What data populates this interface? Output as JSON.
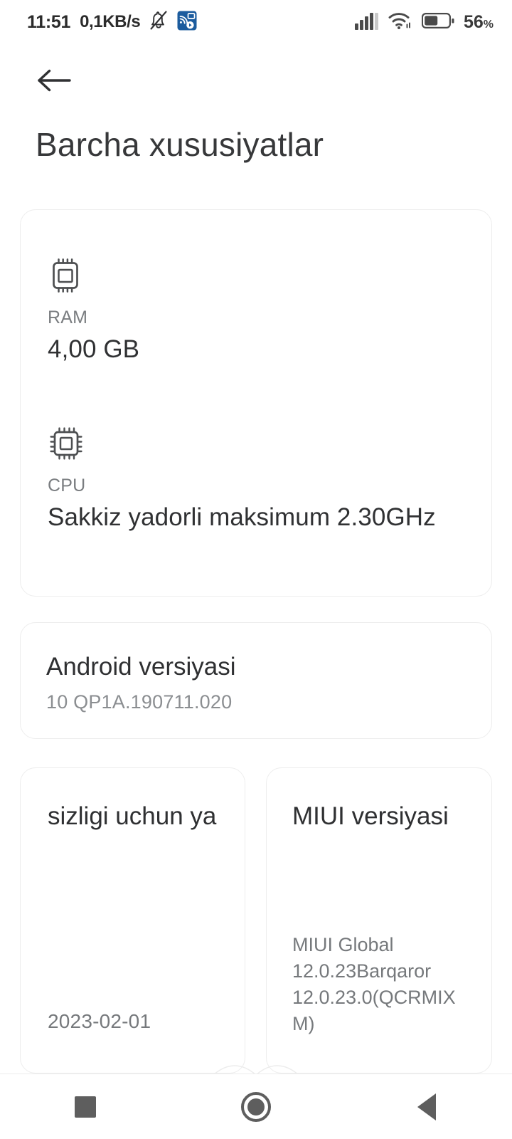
{
  "statusbar": {
    "time": "11:51",
    "network_speed": "0,1KB/s",
    "silent_icon": "bell-muted-icon",
    "cast_icon": "screen-cast-icon",
    "signal_icon": "cellular-signal-icon",
    "wifi_icon": "wifi-icon",
    "battery_icon": "battery-icon",
    "battery_percent": "56",
    "battery_percent_symbol": "%"
  },
  "header": {
    "back_icon": "arrow-left-icon",
    "title": "Barcha xususiyatlar"
  },
  "specs_card": {
    "ram": {
      "icon": "memory-chip-icon",
      "label": "RAM",
      "value": "4,00 GB"
    },
    "cpu": {
      "icon": "cpu-chip-icon",
      "label": "CPU",
      "value": "Sakkiz yadorli maksimum 2.30GHz"
    }
  },
  "android_card": {
    "title": "Android versiyasi",
    "value": "10 QP1A.190711.020"
  },
  "security_card": {
    "title": "sizligi uchun ya",
    "value": "2023-02-01"
  },
  "miui_card": {
    "title": "MIUI versiyasi",
    "value": "MIUI Global 12.0.23Barqaror 12.0.23.0(QCRMIXM)"
  },
  "navbar": {
    "recents_icon": "square-recents-icon",
    "home_icon": "circle-home-icon",
    "back_icon": "triangle-back-icon"
  },
  "colors": {
    "background": "#ffffff",
    "card_border": "#ededed",
    "primary_text": "#2f3032",
    "secondary_text": "#7a7d80",
    "accent_cast": "#1c5c9e",
    "nav_icon": "#5e5e5e"
  }
}
